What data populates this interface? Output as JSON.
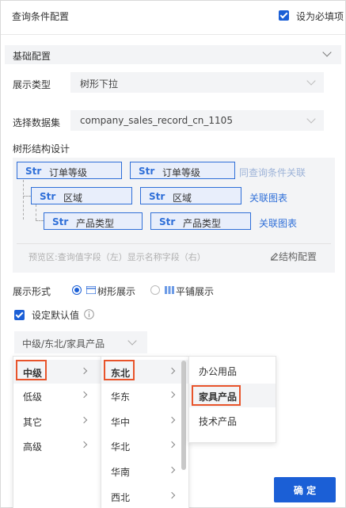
{
  "header": {
    "title": "查询条件配置",
    "required_label": "设为必填项",
    "required_checked": true
  },
  "section": {
    "label": "基础配置"
  },
  "display_type": {
    "label": "展示类型",
    "value": "树形下拉"
  },
  "dataset": {
    "label": "选择数据集",
    "value": "company_sales_record_cn_1105"
  },
  "tree_design": {
    "label": "树形结构设计",
    "str_tag": "Str",
    "rows": [
      {
        "left": "订单等级",
        "right": "订单等级",
        "link": "同查询条件关联",
        "link_muted": true
      },
      {
        "left": "区域",
        "right": "区域",
        "link": "关联图表",
        "link_muted": false
      },
      {
        "left": "产品类型",
        "right": "产品类型",
        "link": "关联图表",
        "link_muted": false
      }
    ],
    "preview_hint": "预览区:查询值字段（左）显示名称字段（右）",
    "struct_config": "结构配置"
  },
  "display_form": {
    "label": "展示形式",
    "option_tree": "树形展示",
    "option_flat": "平铺展示",
    "selected": "树形展示"
  },
  "default_value": {
    "label": "设定默认值",
    "checked": true,
    "info_icon": "info-icon",
    "value": "中级/东北/家具产品"
  },
  "cascader": {
    "col1": [
      {
        "label": "中级",
        "active": true
      },
      {
        "label": "低级"
      },
      {
        "label": "其它"
      },
      {
        "label": "高级"
      }
    ],
    "col2": [
      {
        "label": "东北",
        "active": true
      },
      {
        "label": "华东"
      },
      {
        "label": "华中"
      },
      {
        "label": "华北"
      },
      {
        "label": "华南"
      },
      {
        "label": "西北"
      }
    ],
    "col3": [
      {
        "label": "办公用品"
      },
      {
        "label": "家具产品",
        "active": true
      },
      {
        "label": "技术产品"
      }
    ]
  },
  "footer": {
    "ok_label": "确 定"
  },
  "colors": {
    "accent": "#1b5fd6",
    "highlight": "#e8542b",
    "section_bg": "#f3f4f6"
  }
}
